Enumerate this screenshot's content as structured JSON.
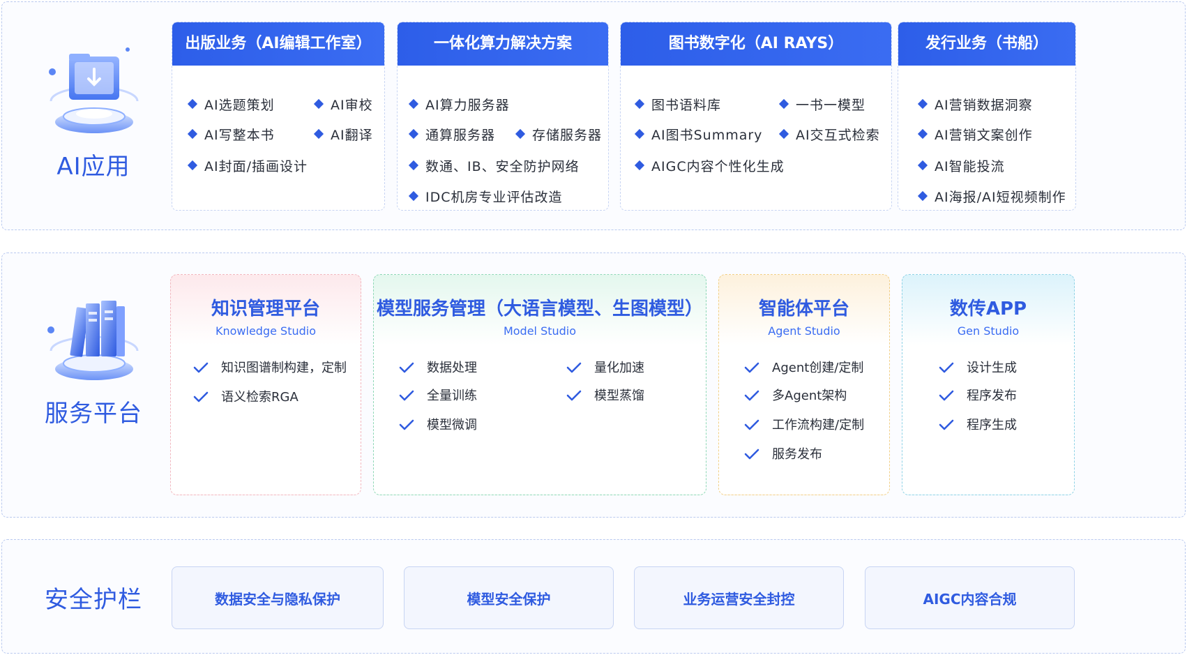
{
  "sections": {
    "ai_apps": {
      "label": "AI应用",
      "cards": [
        {
          "title": "出版业务（AI编辑工作室）",
          "items": [
            "AI选题策划",
            "AI审校",
            "AI写整本书",
            "AI翻译",
            "AI封面/插画设计"
          ]
        },
        {
          "title": "一体化算力解决方案",
          "items": [
            "AI算力服务器",
            "通算服务器",
            "存储服务器",
            "数通、IB、安全防护网络",
            "IDC机房专业评估改造"
          ]
        },
        {
          "title": "图书数字化（AI RAYS）",
          "items": [
            "图书语料库",
            "一书一模型",
            "AI图书Summary",
            "AI交互式检索",
            "AIGC内容个性化生成"
          ]
        },
        {
          "title": "发行业务（书船）",
          "items": [
            "AI营销数据洞察",
            "AI营销文案创作",
            "AI智能投流",
            "AI海报/AI短视频制作"
          ]
        }
      ]
    },
    "service_platform": {
      "label": "服务平台",
      "cards": [
        {
          "title": "知识管理平台",
          "subtitle": "Knowledge Studio",
          "items": [
            "知识图谱制构建，定制",
            "语义检索RGA"
          ]
        },
        {
          "title": "模型服务管理（大语言模型、生图模型）",
          "subtitle": "Model Studio",
          "items": [
            "数据处理",
            "量化加速",
            "全量训练",
            "模型蒸馏",
            "模型微调"
          ]
        },
        {
          "title": "智能体平台",
          "subtitle": "Agent Studio",
          "items": [
            "Agent创建/定制",
            "多Agent架构",
            "工作流构建/定制",
            "服务发布"
          ]
        },
        {
          "title": "数传APP",
          "subtitle": "Gen Studio",
          "items": [
            "设计生成",
            "程序发布",
            "程序生成"
          ]
        }
      ]
    },
    "security": {
      "label": "安全护栏",
      "items": [
        "数据安全与隐私保护",
        "模型安全保护",
        "业务运营安全封控",
        "AIGC内容合规"
      ]
    }
  },
  "colors": {
    "accent": "#2f5be0",
    "header_blue": "#2d5ee9",
    "dashed_border": "#b9c9ef",
    "knowledge_tint": "#fde9ec",
    "model_tint": "#e4f7ee",
    "agent_tint": "#fdf1dd",
    "app_tint": "#dcf3fb"
  },
  "icons": {
    "ai_apps": "folder-download-illustration-icon",
    "service_platform": "bookshelf-illustration-icon",
    "bullet": "diamond-bullet-icon",
    "check": "check-icon"
  }
}
